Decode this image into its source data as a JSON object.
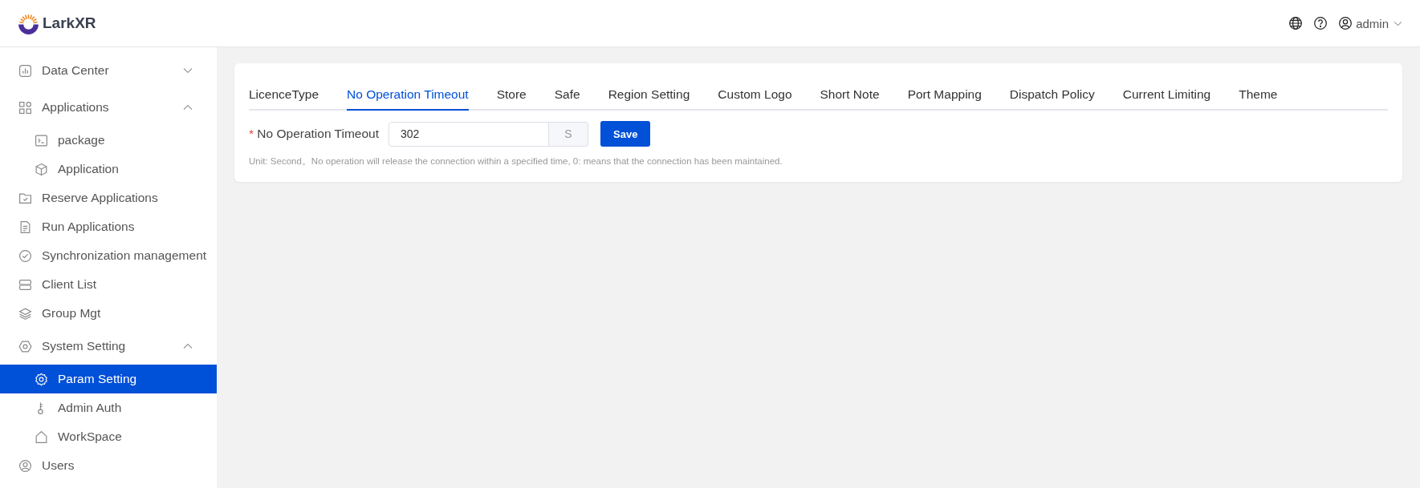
{
  "header": {
    "logo_text": "LarkXR",
    "user": "admin"
  },
  "sidebar": {
    "items": [
      {
        "label": "Data Center",
        "expanded": false,
        "selected": false
      },
      {
        "label": "Applications",
        "expanded": true,
        "selected": false,
        "children": [
          {
            "label": "package",
            "selected": false
          },
          {
            "label": "Application",
            "selected": false
          }
        ]
      },
      {
        "label": "Reserve Applications",
        "selected": false
      },
      {
        "label": "Run Applications",
        "selected": false
      },
      {
        "label": "Synchronization management",
        "selected": false
      },
      {
        "label": "Client List",
        "selected": false
      },
      {
        "label": "Group Mgt",
        "selected": false
      },
      {
        "label": "System Setting",
        "expanded": true,
        "selected": false,
        "children": [
          {
            "label": "Param Setting",
            "selected": true
          },
          {
            "label": "Admin Auth",
            "selected": false
          },
          {
            "label": "WorkSpace",
            "selected": false
          }
        ]
      },
      {
        "label": "Users",
        "selected": false
      }
    ]
  },
  "tabs": [
    {
      "label": "LicenceType",
      "selected": false
    },
    {
      "label": "No Operation Timeout",
      "selected": true
    },
    {
      "label": "Store",
      "selected": false
    },
    {
      "label": "Safe",
      "selected": false
    },
    {
      "label": "Region Setting",
      "selected": false
    },
    {
      "label": "Custom Logo",
      "selected": false
    },
    {
      "label": "Short Note",
      "selected": false
    },
    {
      "label": "Port Mapping",
      "selected": false
    },
    {
      "label": "Dispatch Policy",
      "selected": false
    },
    {
      "label": "Current Limiting",
      "selected": false
    },
    {
      "label": "Theme",
      "selected": false
    }
  ],
  "form": {
    "required_mark": "*",
    "label": "No Operation Timeout",
    "value": "302",
    "suffix": "S",
    "save_button": "Save",
    "hint": "Unit: Second。No operation will release the connection within a specified time, 0: means that the connection has been maintained."
  }
}
